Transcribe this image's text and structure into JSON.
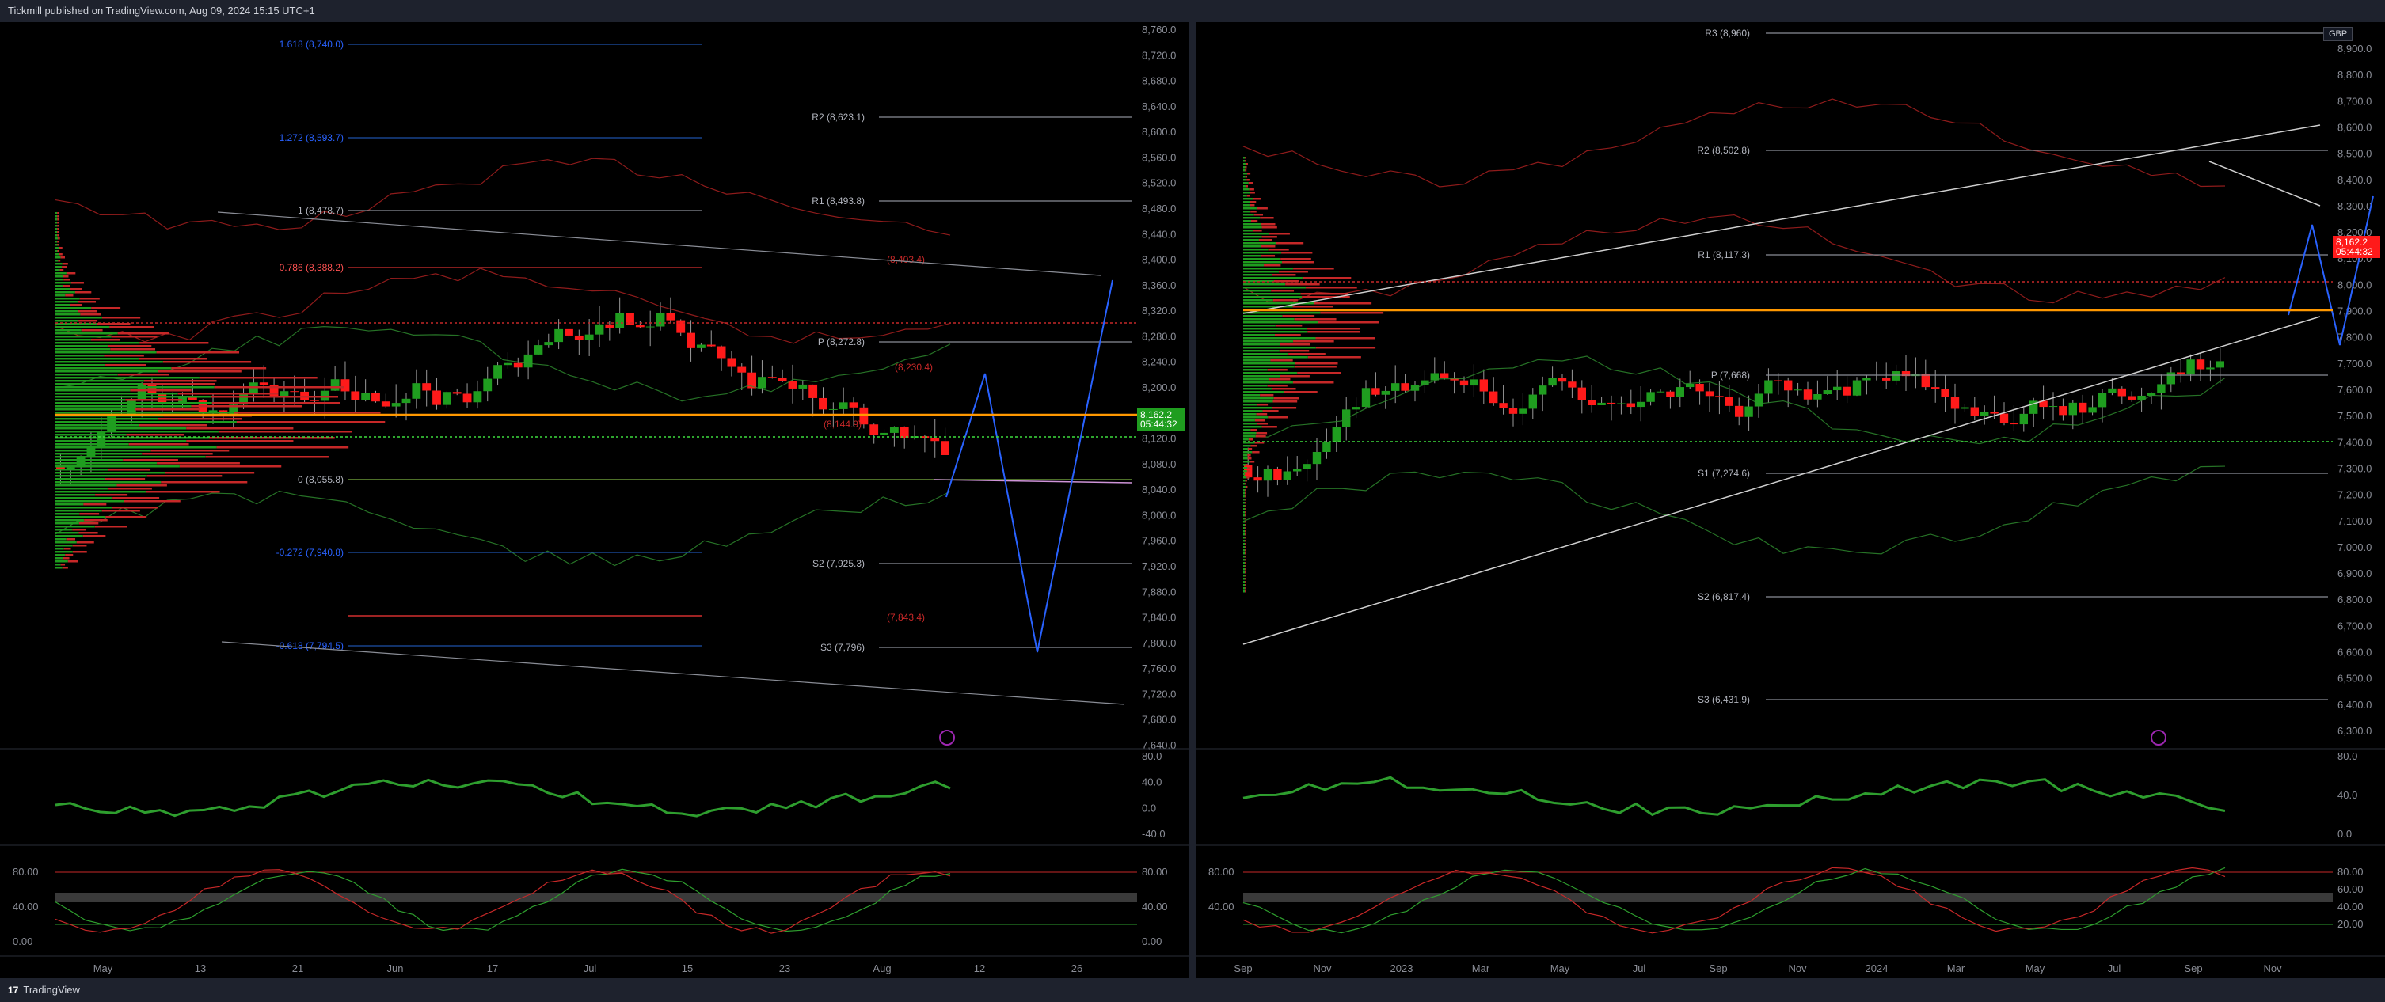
{
  "header": {
    "published": "Tickmill published on TradingView.com, Aug 09, 2024 15:15 UTC+1"
  },
  "footer": {
    "brand": "TradingView"
  },
  "colors": {
    "up": "#1f9d1f",
    "down": "#ff1a1a",
    "grid": "#1c1f27",
    "bg": "#000000",
    "text": "#b2b5be"
  },
  "left_chart": {
    "price_axis": [
      "8,760.0",
      "8,720.0",
      "8,680.0",
      "8,640.0",
      "8,600.0",
      "8,560.0",
      "8,520.0",
      "8,480.0",
      "8,440.0",
      "8,400.0",
      "8,360.0",
      "8,320.0",
      "8,280.0",
      "8,240.0",
      "8,200.0",
      "8,160.0",
      "8,120.0",
      "8,080.0",
      "8,040.0",
      "8,000.0",
      "7,960.0",
      "7,920.0",
      "7,880.0",
      "7,840.0",
      "7,800.0",
      "7,760.0",
      "7,720.0",
      "7,680.0",
      "7,640.0"
    ],
    "time_axis": [
      "May",
      "13",
      "21",
      "Jun",
      "17",
      "Jul",
      "15",
      "23",
      "Aug",
      "12",
      "26"
    ],
    "last_price": "8,162.2",
    "countdown": "05:44:32",
    "fib_labels": [
      "1.618 (8,740.0)",
      "1.272 (8,593.7)",
      "1 (8,478.7)",
      "0.786 (8,388.2)",
      "0 (8,055.8)",
      "-0.272 (7,940.8)",
      "-0.618 (7,794.5)"
    ],
    "pivot_labels": [
      "R2 (8,623.1)",
      "R1 (8,493.8)",
      "P (8,272.8)",
      "S2 (7,925.3)",
      "S3 (7,796)"
    ],
    "other_labels": [
      "(8,403.4)",
      "(8,230.4)",
      "(8,144.9)",
      "(7,843.4)"
    ],
    "rsi_axis": [
      "80.0",
      "40.0",
      "0.0",
      "-40.0"
    ],
    "stoch_axis": [
      "80.00",
      "40.00",
      "0.00"
    ],
    "stoch_axis_right": [
      "80.00",
      "40.00",
      "0.00"
    ]
  },
  "right_chart": {
    "currency": "GBP",
    "price_axis": [
      "8,900.0",
      "8,800.0",
      "8,700.0",
      "8,600.0",
      "8,500.0",
      "8,400.0",
      "8,300.0",
      "8,200.0",
      "8,100.0",
      "8,000.0",
      "7,900.0",
      "7,800.0",
      "7,700.0",
      "7,600.0",
      "7,500.0",
      "7,400.0",
      "7,300.0",
      "7,200.0",
      "7,100.0",
      "7,000.0",
      "6,900.0",
      "6,800.0",
      "6,700.0",
      "6,600.0",
      "6,500.0",
      "6,400.0",
      "6,300.0"
    ],
    "time_axis": [
      "Sep",
      "Nov",
      "2023",
      "Mar",
      "May",
      "Jul",
      "Sep",
      "Nov",
      "2024",
      "Mar",
      "May",
      "Jul",
      "Sep",
      "Nov"
    ],
    "last_price": "8,162.2",
    "countdown": "05:44:32",
    "pivot_labels": [
      "R3 (8,960)",
      "R2 (8,502.8)",
      "R1 (8,117.3)",
      "P (7,668)",
      "S1 (7,274.6)",
      "S2 (6,817.4)",
      "S3 (6,431.9)"
    ],
    "rsi_axis": [
      "80.0",
      "40.0",
      "0.0"
    ],
    "stoch_axis": [
      "80.00",
      "40.00"
    ],
    "stoch_axis_right": [
      "80.00",
      "60.00",
      "40.00",
      "20.00"
    ]
  }
}
